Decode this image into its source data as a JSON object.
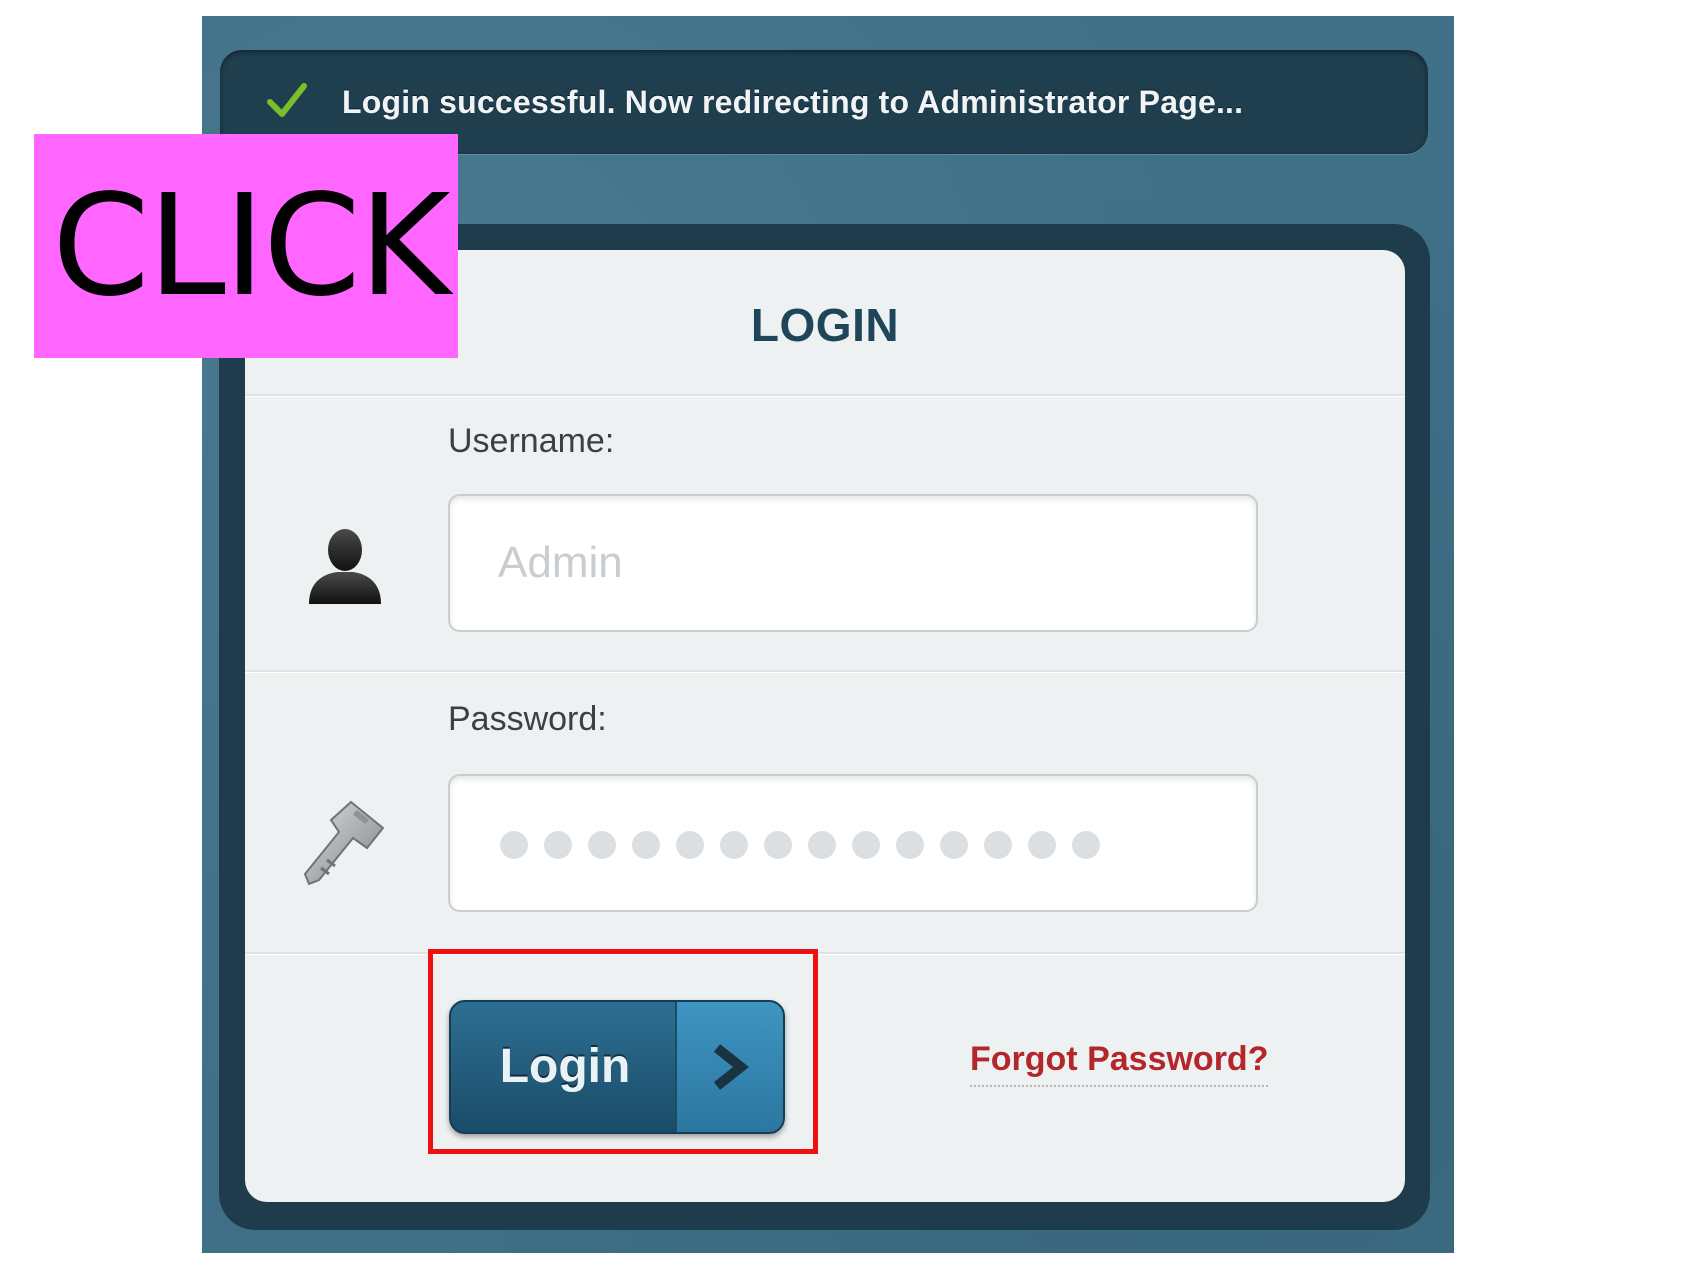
{
  "notice": {
    "message": "Login successful. Now redirecting to Administrator Page...",
    "icon": "check-icon",
    "icon_color": "#7bbf2a"
  },
  "annotation": {
    "badge_text": "CLICK",
    "badge_color": "#ff66ff",
    "highlight_color": "#ee1111"
  },
  "login_form": {
    "title": "LOGIN",
    "username": {
      "label": "Username:",
      "placeholder": "Admin",
      "icon": "user-icon"
    },
    "password": {
      "label": "Password:",
      "masked_length": 14,
      "icon": "key-icon"
    },
    "submit_label": "Login",
    "submit_icon": "chevron-right-icon",
    "forgot_link": "Forgot Password?"
  },
  "colors": {
    "frame_background": "#3f7088",
    "panel_background": "#eef1f2",
    "button_primary": "#1f5674",
    "link_red": "#b3262a"
  }
}
